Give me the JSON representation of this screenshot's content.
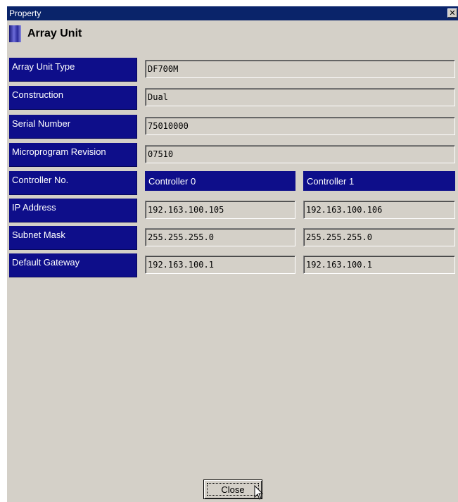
{
  "window": {
    "title": "Property",
    "close_glyph": "✕"
  },
  "heading": {
    "icon": "array-unit-icon",
    "text": "Array Unit"
  },
  "rows": [
    {
      "label": "Array Unit Type",
      "value": "DF700M"
    },
    {
      "label": "Construction",
      "value": "Dual"
    },
    {
      "label": "Serial Number",
      "value": "75010000"
    },
    {
      "label": "Microprogram Revision",
      "value": "07510"
    }
  ],
  "controller": {
    "label": "Controller No.",
    "col0": "Controller 0",
    "col1": "Controller 1"
  },
  "network": [
    {
      "label": "IP Address",
      "c0": "192.163.100.105",
      "c1": "192.163.100.106"
    },
    {
      "label": "Subnet Mask",
      "c0": "255.255.255.0",
      "c1": "255.255.255.0"
    },
    {
      "label": "Default Gateway",
      "c0": "192.163.100.1",
      "c1": "192.163.100.1"
    }
  ],
  "buttons": {
    "close": "Close"
  },
  "colors": {
    "titlebar": "#0a246a",
    "label_bg": "#0e0e8a",
    "window_bg": "#d4d0c8"
  }
}
